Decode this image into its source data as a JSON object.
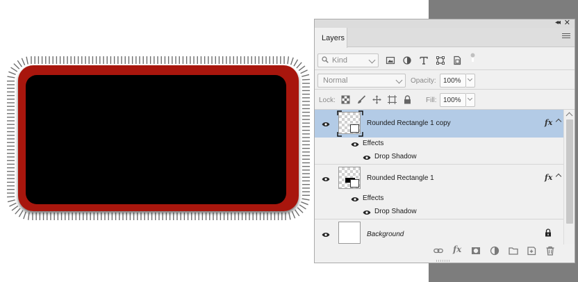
{
  "panel": {
    "collapse_icon": "double-chevron-icon",
    "close_icon": "close-icon",
    "tab_label": "Layers",
    "menu_icon": "panel-menu-icon"
  },
  "filter": {
    "kind_label": "Kind",
    "icons": [
      "pixel-filter-icon",
      "adjustment-filter-icon",
      "type-filter-icon",
      "shape-filter-icon",
      "smart-object-filter-icon",
      "filter-toggle-icon"
    ]
  },
  "blend": {
    "mode": "Normal",
    "opacity_label": "Opacity:",
    "opacity_value": "100%"
  },
  "lock": {
    "label": "Lock:",
    "fill_label": "Fill:",
    "fill_value": "100%",
    "icons": [
      "lock-transparent-icon",
      "lock-pixels-icon",
      "lock-position-icon",
      "lock-artboard-icon",
      "lock-all-icon"
    ]
  },
  "layers": [
    {
      "name": "Rounded Rectangle 1 copy",
      "selected": true,
      "fx": "fx",
      "effects_label": "Effects",
      "effect_name": "Drop Shadow"
    },
    {
      "name": "Rounded Rectangle 1",
      "selected": false,
      "fx": "fx",
      "effects_label": "Effects",
      "effect_name": "Drop Shadow"
    },
    {
      "name": "Background",
      "selected": false,
      "locked": true
    }
  ],
  "bottom_icons": [
    "link-icon",
    "fx-icon",
    "mask-icon",
    "adjustment-icon",
    "group-folder-icon",
    "new-layer-icon",
    "trash-icon"
  ],
  "colors": {
    "selected_row": "#b3cbe6",
    "panel_bg": "#f0f0f0",
    "workspace": "#7d7d7d",
    "frame_red": "#a8190b",
    "shape_fill": "#000000"
  }
}
